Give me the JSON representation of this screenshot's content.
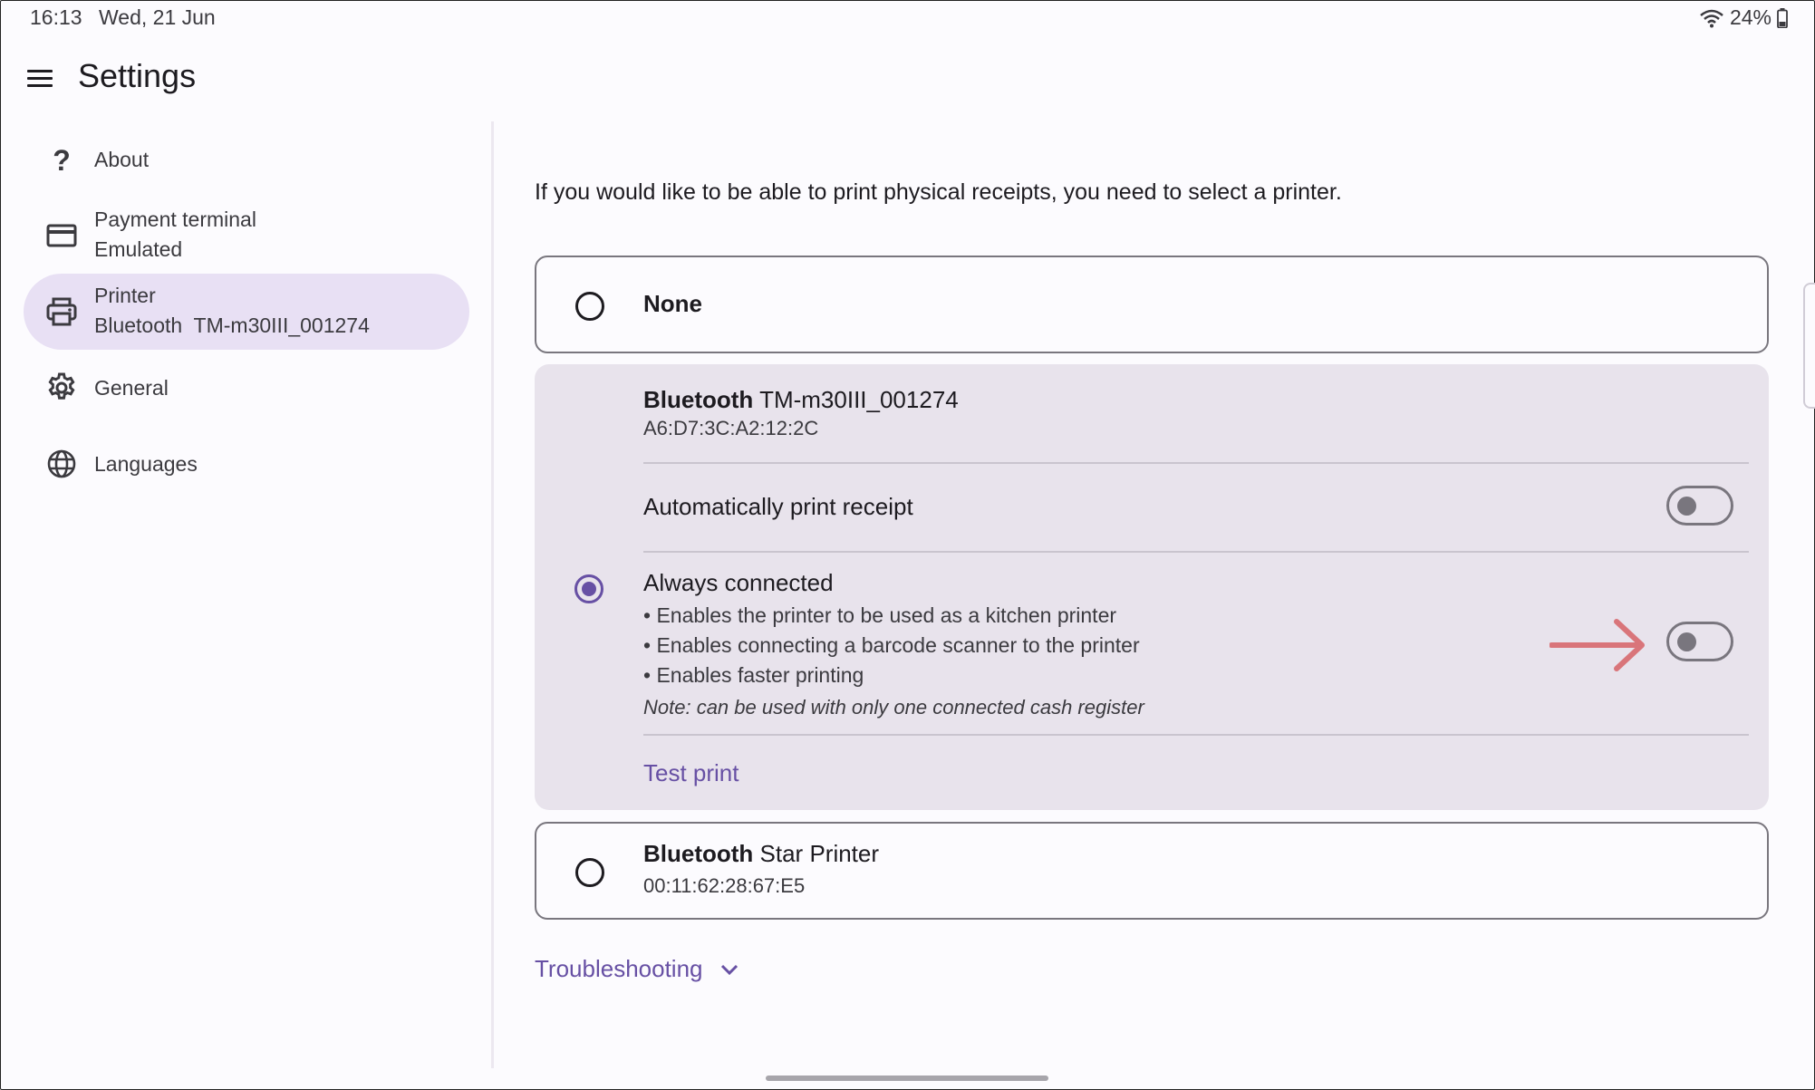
{
  "status_bar": {
    "time": "16:13",
    "date": "Wed, 21 Jun",
    "battery": "24%",
    "icons": [
      "wifi-icon",
      "battery-icon"
    ]
  },
  "app_bar": {
    "title": "Settings",
    "menu_icon": "hamburger-menu-icon"
  },
  "sidebar": {
    "items": [
      {
        "label": "About",
        "icon": "question-mark-icon"
      },
      {
        "label": "Payment terminal",
        "sublabel": "Emulated",
        "icon": "credit-card-icon"
      },
      {
        "label": "Printer",
        "sublabel": "Bluetooth  TM-m30III_001274",
        "icon": "printer-icon",
        "active": true
      },
      {
        "label": "General",
        "icon": "gear-icon"
      },
      {
        "label": "Languages",
        "icon": "globe-icon"
      }
    ]
  },
  "main": {
    "intro": "If you would like to be able to print physical receipts, you need to select a printer.",
    "options": [
      {
        "title_bold": "None",
        "selected": false
      },
      {
        "title_bold": "Bluetooth",
        "title_rest": " TM-m30III_001274",
        "address": "A6:D7:3C:A2:12:2C",
        "selected": true,
        "settings": {
          "auto_print_label": "Automatically print receipt",
          "auto_print_on": false,
          "always_connected_label": "Always connected",
          "always_connected_on": false,
          "bullets": [
            "• Enables the printer to be used as a kitchen printer",
            "• Enables connecting a barcode scanner to the printer",
            "• Enables faster printing"
          ],
          "note": "Note: can be used with only one connected cash register",
          "test_print": "Test print"
        }
      },
      {
        "title_bold": "Bluetooth",
        "title_rest": " Star Printer",
        "address": "00:11:62:28:67:E5",
        "selected": false
      }
    ],
    "troubleshooting": "Troubleshooting"
  },
  "colors": {
    "accent": "#6750a4",
    "selected_bg": "#e8e0f4",
    "card_selected_bg": "#e8e3ec",
    "annotation_arrow": "#d9757a"
  }
}
